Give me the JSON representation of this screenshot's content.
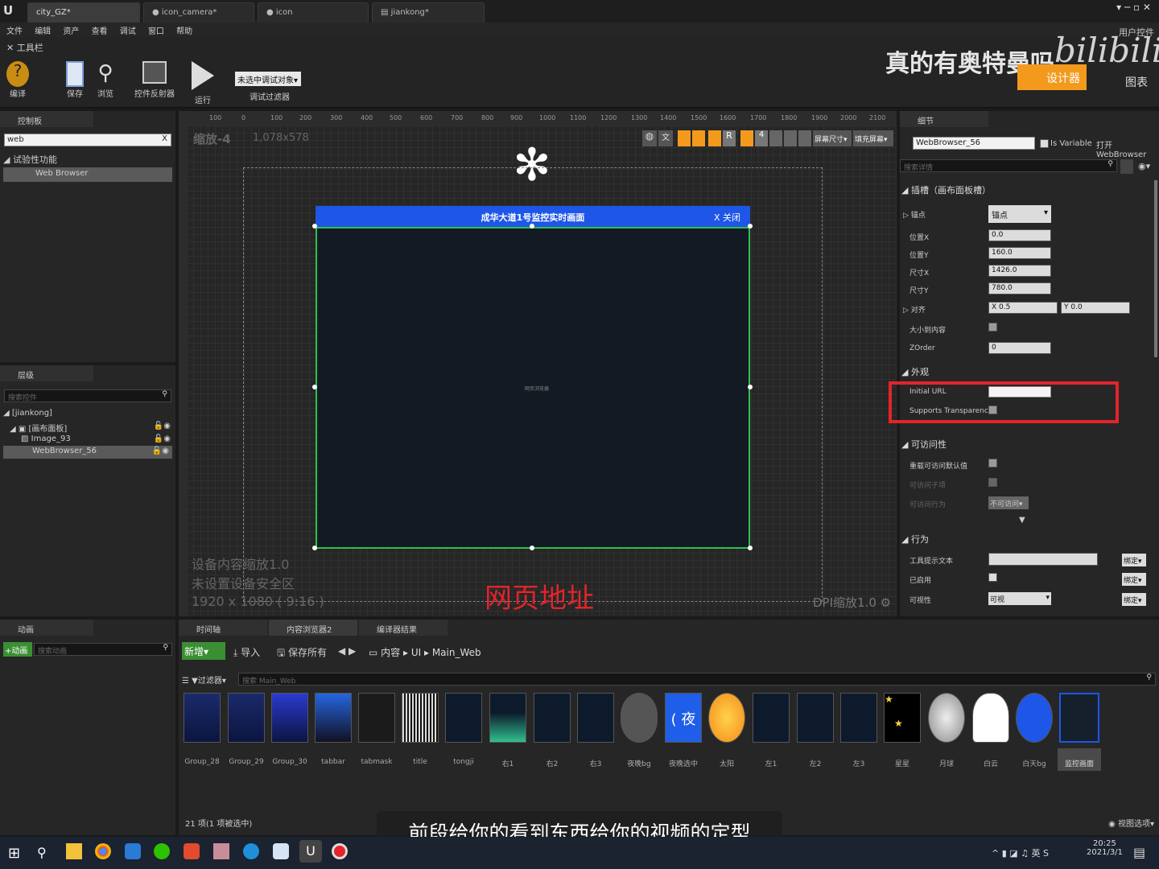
{
  "window_tabs": [
    {
      "label": "city_GZ*"
    },
    {
      "label": "icon_camera*"
    },
    {
      "label": "icon"
    },
    {
      "label": "jiankong*"
    }
  ],
  "menu": [
    "文件",
    "编辑",
    "资产",
    "查看",
    "调试",
    "窗口",
    "帮助"
  ],
  "toolbar": {
    "label": "工具栏",
    "compile": "编译",
    "save": "保存",
    "browse": "浏览",
    "widget_reflector": "控件反射器",
    "run": "运行",
    "debug_select": "未选中调试对象▾",
    "debug_filter": "调试过滤器"
  },
  "top_right": {
    "user_widget": "用户控件",
    "designer": "设计器",
    "graph": "图表",
    "overlay_text": "真的有奥特曼吗"
  },
  "palette": {
    "title": "控制板",
    "search_value": "web",
    "category": "试验性功能",
    "item": "Web Browser"
  },
  "hierarchy": {
    "title": "层级",
    "search_placeholder": "搜索控件",
    "items": [
      "[jiankong]",
      "[画布面板]",
      "Image_93",
      "WebBrowser_56"
    ]
  },
  "canvas": {
    "zoom": "缩放-4",
    "size_readout": "1,078x578",
    "ruler": [
      "100",
      "0",
      "100",
      "200",
      "300",
      "400",
      "500",
      "600",
      "700",
      "800",
      "900",
      "1000",
      "1100",
      "1200",
      "1300",
      "1400",
      "1500",
      "1600",
      "1700",
      "1800",
      "1900",
      "2000",
      "2100"
    ],
    "browser_title": "成华大道1号监控实时画面",
    "browser_close": "X 关闭",
    "browser_center": "网页浏览器",
    "device_scale": "设备内容缩放1.0",
    "no_safe_zone": "未设置设备安全区",
    "resolution": "1920 x 1080 ( 9:16 )",
    "dpi": "DPI缩放1.0",
    "annotation": "网页地址",
    "screen_size": "屏幕尺寸▾",
    "fill_screen": "填充屏幕▾"
  },
  "details": {
    "title": "细节",
    "name": "WebBrowser_56",
    "is_variable": "Is Variable",
    "open_link": "打开WebBrowser",
    "search_placeholder": "搜索详情",
    "slot_section": "插槽（画布面板槽）",
    "anchor_label": "锚点",
    "anchor_value": "锚点",
    "pos_x_label": "位置X",
    "pos_x": "0.0",
    "pos_y_label": "位置Y",
    "pos_y": "160.0",
    "size_x_label": "尺寸X",
    "size_x": "1426.0",
    "size_y_label": "尺寸Y",
    "size_y": "780.0",
    "align_label": "对齐",
    "align_x": "X 0.5",
    "align_y": "Y 0.0",
    "size_to_content": "大小到内容",
    "zorder_label": "ZOrder",
    "zorder": "0",
    "appearance": "外观",
    "initial_url": "Initial URL",
    "supports_transparency": "Supports Transparency",
    "accessibility": "可访问性",
    "override_access": "重载可访问默认值",
    "access_children": "可访问子项",
    "access_as": "可访问行为",
    "access_value": "不可访问▾",
    "behavior": "行为",
    "tooltip": "工具提示文本",
    "enabled": "已启用",
    "visibility": "可视性",
    "visibility_value": "可视",
    "bind": "绑定▾"
  },
  "animation": {
    "title": "动画",
    "add": "+动画",
    "search_placeholder": "搜索动画"
  },
  "bottom_tabs": [
    "时间轴",
    "内容浏览器2",
    "编译器结果"
  ],
  "content_browser": {
    "new": "新增▾",
    "import": "导入",
    "save_all": "保存所有",
    "path": [
      "内容",
      "UI",
      "Main_Web"
    ],
    "filter": "过滤器▾",
    "search_placeholder": "搜索 Main_Web",
    "status": "21 项(1 项被选中)",
    "view_options": "视图选项▾",
    "assets": [
      "Group_28",
      "Group_29",
      "Group_30",
      "tabbar",
      "tabmask",
      "title",
      "tongji",
      "右1",
      "右2",
      "右3",
      "夜晚bg",
      "夜晚选中",
      "太阳",
      "左1",
      "左2",
      "左3",
      "星星",
      "月球",
      "白云",
      "白天bg",
      "监控画面"
    ]
  },
  "subtitle": "前段给你的看到东西给你的视频的定型",
  "taskbar": {
    "time": "20:25",
    "date": "2021/3/1",
    "ime": "英"
  },
  "colors": {
    "blue_bar": "#1e56e8",
    "highlight": "#e3242b",
    "selection_orange": "#f39a1c"
  }
}
